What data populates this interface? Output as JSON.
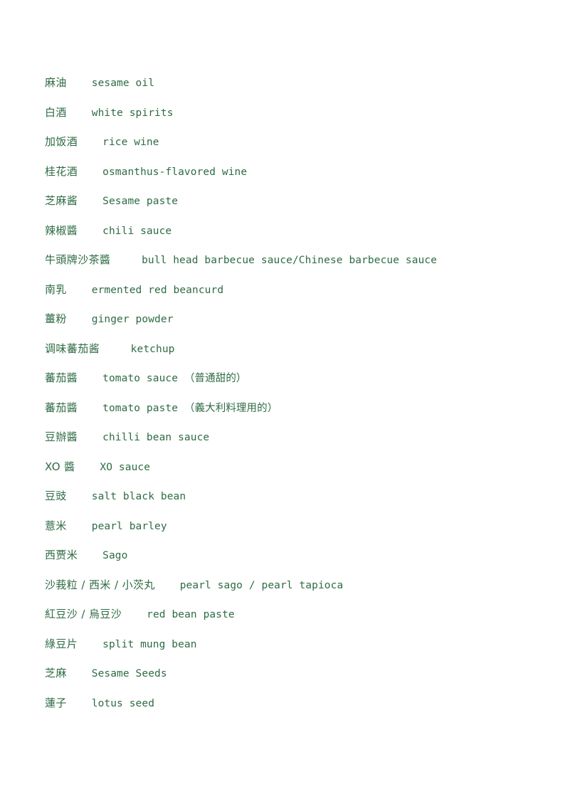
{
  "document": {
    "type": "glossary",
    "language_pair": "Chinese-English",
    "text_color": "#2e6b43",
    "background_color": "#ffffff",
    "entries": [
      {
        "term": "麻油",
        "gap": "    ",
        "gloss": "sesame oil"
      },
      {
        "term": "白酒",
        "gap": "    ",
        "gloss": "white spirits"
      },
      {
        "term": "加饭酒",
        "gap": "    ",
        "gloss": "rice wine"
      },
      {
        "term": "桂花酒",
        "gap": "    ",
        "gloss": "osmanthus-flavored wine"
      },
      {
        "term": "芝麻酱",
        "gap": "    ",
        "gloss": "Sesame paste"
      },
      {
        "term": "辣椒醬",
        "gap": "    ",
        "gloss": "chili sauce"
      },
      {
        "term": "牛頭牌沙茶醬",
        "gap": "     ",
        "gloss": "bull head barbecue sauce/Chinese barbecue sauce"
      },
      {
        "term": "南乳",
        "gap": "    ",
        "gloss": "ermented red beancurd"
      },
      {
        "term": "薑粉",
        "gap": "    ",
        "gloss": "ginger powder"
      },
      {
        "term": "调味蕃茄酱",
        "gap": "     ",
        "gloss": "ketchup"
      },
      {
        "term": "蕃茄醬",
        "gap": "    ",
        "gloss": "tomato sauce",
        "note": "（普通甜的）"
      },
      {
        "term": "蕃茄醬",
        "gap": "    ",
        "gloss": "tomato paste",
        "note": "（義大利料理用的）"
      },
      {
        "term": "豆辦醬",
        "gap": "    ",
        "gloss": "chilli bean sauce"
      },
      {
        "term": "XO 醬",
        "gap": "    ",
        "gloss": "XO sauce"
      },
      {
        "term": "豆豉",
        "gap": "    ",
        "gloss": "salt black bean"
      },
      {
        "term": "薏米",
        "gap": "    ",
        "gloss": "pearl barley"
      },
      {
        "term": "西贾米",
        "gap": "    ",
        "gloss": "Sago"
      },
      {
        "term": "沙莪粒 / 西米 / 小茨丸",
        "gap": "    ",
        "gloss": "pearl sago / pearl tapioca"
      },
      {
        "term": "紅豆沙 / 烏豆沙",
        "gap": "    ",
        "gloss": "red bean paste"
      },
      {
        "term": "綠豆片",
        "gap": "    ",
        "gloss": "split mung bean"
      },
      {
        "term": "芝麻",
        "gap": "    ",
        "gloss": "Sesame Seeds"
      },
      {
        "term": "蓮子",
        "gap": "    ",
        "gloss": "lotus seed"
      }
    ]
  }
}
